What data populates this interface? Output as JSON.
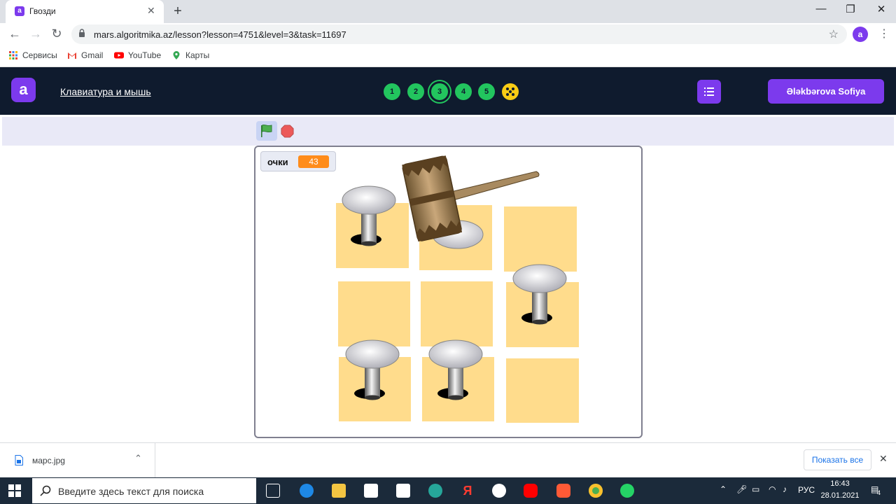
{
  "browser": {
    "tab_title": "Гвозди",
    "url": "mars.algoritmika.az/lesson?lesson=4751&level=3&task=11697",
    "bookmarks": [
      "Сервисы",
      "Gmail",
      "YouTube",
      "Карты"
    ]
  },
  "app": {
    "logo_letter": "a",
    "course_title": "Клавиатура и мышь",
    "levels": [
      "1",
      "2",
      "3",
      "4",
      "5"
    ],
    "active_level": "3",
    "user_name": "Ələkbərova Sofiya"
  },
  "game": {
    "score_label": "очки",
    "score_value": "43",
    "grid_rows": 3,
    "grid_cols": 3,
    "nails_present": [
      "r1c1",
      "r2c3",
      "r3c1",
      "r3c2"
    ],
    "nail_hammered": "r1c2",
    "colors": {
      "tile": "#ffdc8c",
      "score_badge": "#ff8c1a",
      "accent": "#7c3aed",
      "level": "#22c55e"
    }
  },
  "downloads": {
    "file_name": "марс.jpg",
    "show_all_label": "Показать все"
  },
  "taskbar": {
    "search_placeholder": "Введите здесь текст для поиска",
    "language": "РУС",
    "time": "16:43",
    "date": "28.01.2021",
    "notification_count": "4"
  }
}
